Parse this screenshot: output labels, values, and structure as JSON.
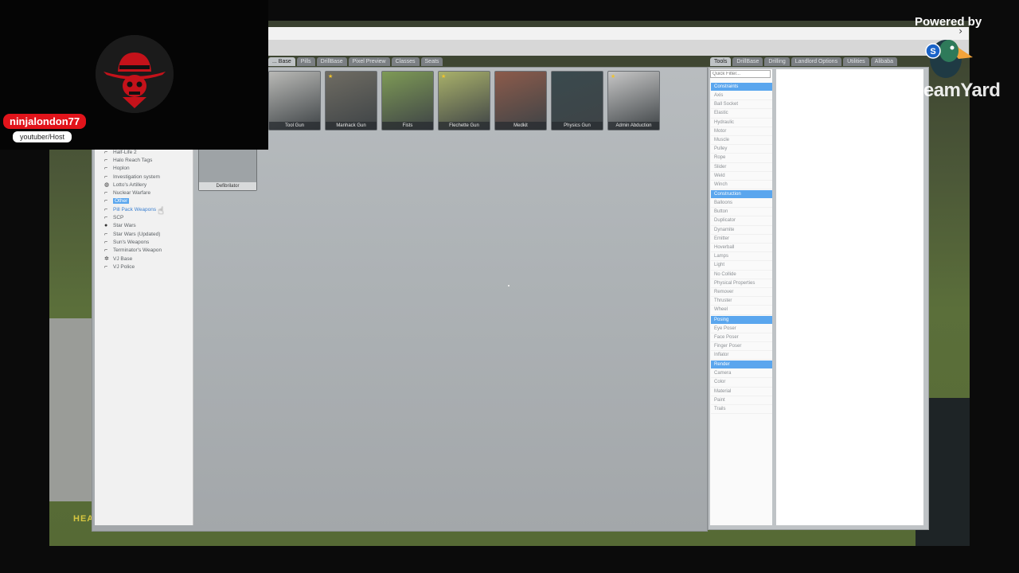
{
  "stream": {
    "host_name": "ninjalondon77",
    "host_role": "youtuber/Host",
    "powered_by": "Powered by",
    "brand": "StreamYard"
  },
  "hud": {
    "health_label": "HEA"
  },
  "left_tabs": [
    "... Base",
    "Pills",
    "DrillBase",
    "Pixel Preview",
    "Classes",
    "Seats"
  ],
  "right_tabs": [
    "Tools",
    "DrillBase",
    "Drilling",
    "Landlord Options",
    "Utilities",
    "Alibaba"
  ],
  "categories": [
    {
      "label": "Half-Life 2",
      "icon": "gun-icon"
    },
    {
      "label": "Halo Reach Tags",
      "icon": "gun-icon"
    },
    {
      "label": "Hoplon",
      "icon": "gun-icon"
    },
    {
      "label": "Investigation system",
      "icon": "gun-icon"
    },
    {
      "label": "Lotto's Artillery",
      "icon": "person-icon"
    },
    {
      "label": "Nuclear Warfare",
      "icon": "gun-icon"
    },
    {
      "label": "Other",
      "icon": "gun-icon",
      "selected": true
    },
    {
      "label": "Pill Pack Weapons",
      "icon": "gun-icon",
      "hover": true
    },
    {
      "label": "SCP",
      "icon": "gun-icon"
    },
    {
      "label": "Star Wars",
      "icon": "ball-icon"
    },
    {
      "label": "Star Wars (Updated)",
      "icon": "gun-icon"
    },
    {
      "label": "Sun's Weapons",
      "icon": "gun-icon"
    },
    {
      "label": "Terminator's Weapon",
      "icon": "gun-icon"
    },
    {
      "label": "VJ Base",
      "icon": "gear-icon"
    },
    {
      "label": "VJ Police",
      "icon": "gun-icon"
    }
  ],
  "weapons": [
    {
      "label": "Tool Gun",
      "color": "#b9b9b6",
      "starred": false
    },
    {
      "label": "Manhack Gun",
      "color": "#6f6c63",
      "starred": true
    },
    {
      "label": "Fists",
      "color": "#7e9a56",
      "starred": false
    },
    {
      "label": "Flechette Gun",
      "color": "#a8b06a",
      "starred": true
    },
    {
      "label": "Medkit",
      "color": "#8c5b4b",
      "starred": false
    },
    {
      "label": "Physics Gun",
      "color": "#3a4a4e",
      "starred": false
    },
    {
      "label": "Admin Abduction",
      "color": "#c6c6c6",
      "starred": true
    }
  ],
  "defibrillator": "Defibrilator",
  "tools": {
    "quick_filter_placeholder": "Quick Filter...",
    "groups": [
      {
        "name": "Constraints",
        "items": [
          "Axis",
          "Ball Socket",
          "Elastic",
          "Hydraulic",
          "Motor",
          "Muscle",
          "Pulley",
          "Rope",
          "Slider",
          "Weld",
          "Winch"
        ]
      },
      {
        "name": "Construction",
        "items": [
          "Balloons",
          "Button",
          "Duplicator",
          "Dynamite",
          "Emitter",
          "Hoverball",
          "Lamps",
          "Light",
          "No Collide",
          "Physical Properties",
          "Remover",
          "Thruster",
          "Wheel"
        ]
      },
      {
        "name": "Posing",
        "items": [
          "Eye Poser",
          "Face Poser",
          "Finger Poser",
          "Inflator"
        ]
      },
      {
        "name": "Render",
        "items": [
          "Camera",
          "Color",
          "Material",
          "Paint",
          "Trails"
        ]
      }
    ]
  }
}
